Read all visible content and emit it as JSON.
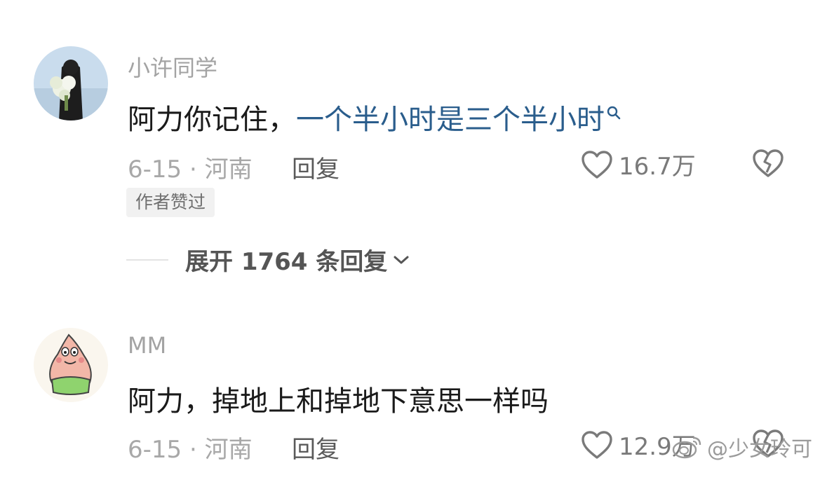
{
  "comments": [
    {
      "username": "小许同学",
      "text_prefix": "阿力你记住，",
      "text_link": "一个半小时是三个半小时",
      "meta": "6-15 · 河南",
      "reply_label": "回复",
      "likes": "16.7万",
      "badge": "作者赞过",
      "expand_label": "展开 1764 条回复"
    },
    {
      "username": "MM",
      "text": "阿力，掉地上和掉地下意思一样吗",
      "meta": "6-15 · 河南",
      "reply_label": "回复",
      "likes": "12.9万"
    }
  ],
  "watermark": "@少女玲可",
  "colors": {
    "link": "#2a5d8c",
    "username": "#a3a3a3",
    "meta": "#a8a8a8"
  }
}
